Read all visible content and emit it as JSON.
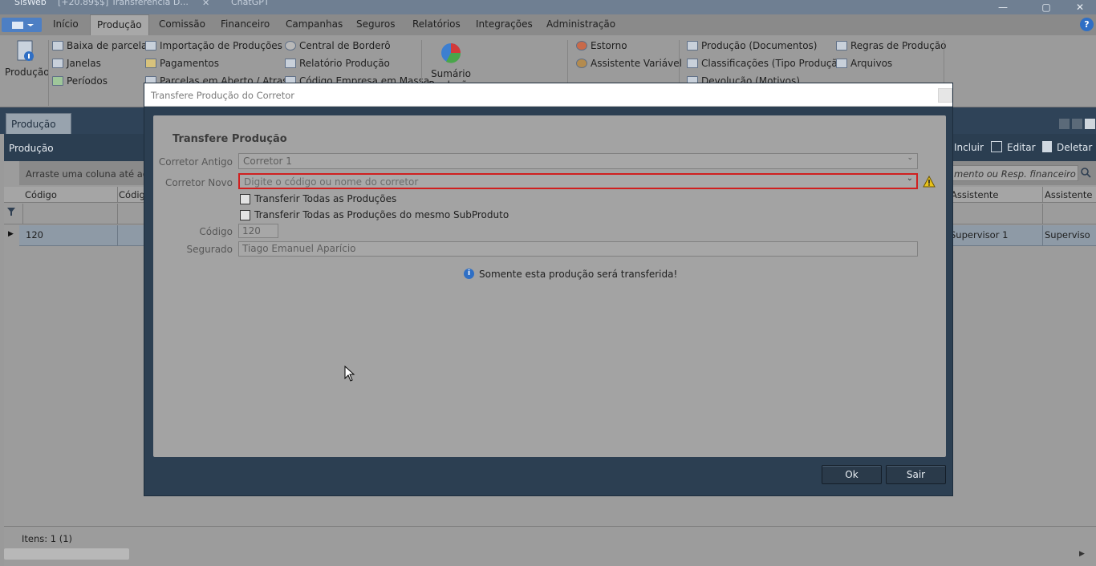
{
  "window": {
    "app_title": "SisWeb",
    "browser_tabs": [
      "[+20.89$$] Transferência D...",
      "ChatGPT"
    ],
    "minimize": "—",
    "maximize": "▢",
    "close": "✕"
  },
  "ribbon": {
    "tabs": [
      "Início",
      "Produção",
      "Comissão",
      "Financeiro",
      "Campanhas",
      "Seguros",
      "Relatórios",
      "Integrações",
      "Administração"
    ],
    "active_tab": "Produção",
    "big_producao": "Produção",
    "group1": [
      "Baixa de parcelas",
      "Janelas",
      "Períodos"
    ],
    "group2": [
      "Importação de Produções",
      "Pagamentos",
      "Parcelas em Aberto / Atraso"
    ],
    "group3": [
      "Central de Borderô",
      "Relatório Produção",
      "Código Empresa em Massa"
    ],
    "big_sumario": "Sumário",
    "big_sumario_sub": "Produção",
    "group4": [
      "Estorno",
      "Assistente Variável"
    ],
    "group5": [
      "Produção (Documentos)",
      "Classificações (Tipo Produção)",
      "Devolução (Motivos)"
    ],
    "group6": [
      "Regras de Produção",
      "Arquivos"
    ]
  },
  "document": {
    "tab_label": "Produção",
    "panel_title": "Produção",
    "actions": {
      "incluir": "Incluir",
      "editar": "Editar",
      "deletar": "Deletar"
    },
    "group_hint": "Arraste uma coluna até aqui p",
    "search_placeholder": "mento ou Resp. financeiro",
    "columns_left": [
      "Código",
      "Códig"
    ],
    "columns_right": [
      "Assistente",
      "Assistente"
    ],
    "row": {
      "codigo": "120",
      "assistente": "Supervisor 1",
      "assistente2": "Superviso"
    },
    "footer": "Itens: 1 (1)"
  },
  "modal": {
    "title": "Transfere Produção do Corretor",
    "section_title": "Transfere Produção",
    "corretor_antigo_label": "Corretor Antigo",
    "corretor_antigo_value": "Corretor 1",
    "corretor_novo_label": "Corretor Novo",
    "corretor_novo_placeholder": "Digite o código ou nome do corretor",
    "check_all": "Transferir Todas as Produções",
    "check_subproduto": "Transferir Todas as Produções do mesmo SubProduto",
    "codigo_label": "Código",
    "codigo_value": "120",
    "segurado_label": "Segurado",
    "segurado_value": "Tiago Emanuel Aparício",
    "info": "Somente esta produção será transferida!",
    "ok": "Ok",
    "sair": "Sair"
  }
}
